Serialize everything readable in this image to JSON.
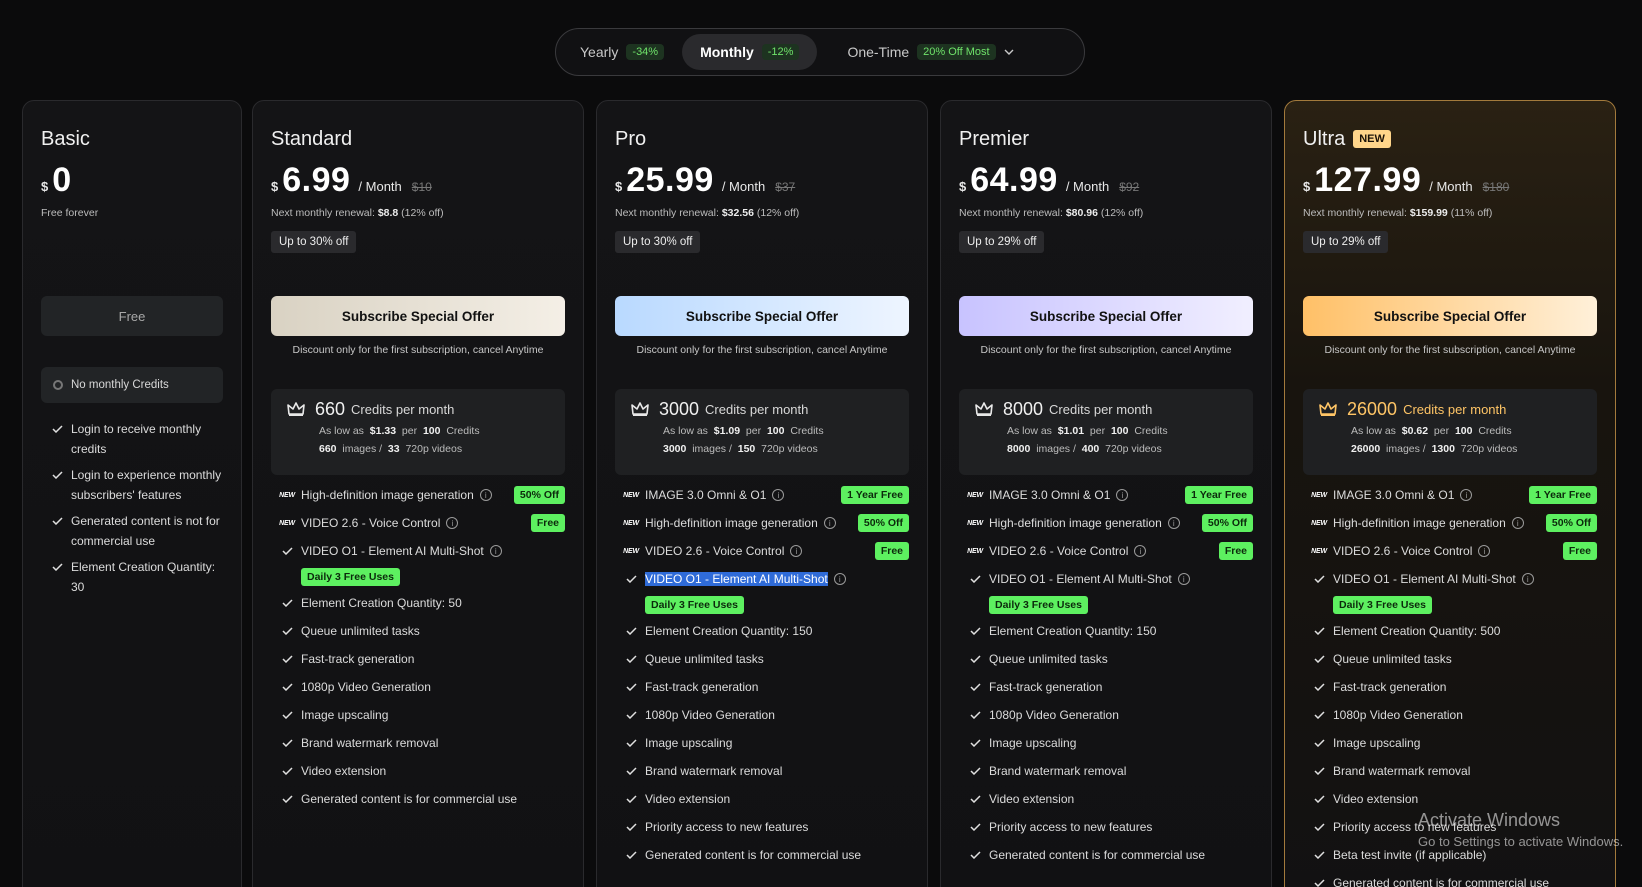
{
  "billing": {
    "options": [
      {
        "label": "Yearly",
        "badge": "-34%"
      },
      {
        "label": "Monthly",
        "badge": "-12%"
      },
      {
        "label": "One-Time",
        "badge": "20% Off Most"
      }
    ]
  },
  "common": {
    "currency": "$",
    "period": "/ Month",
    "subscribe": "Subscribe Special Offer",
    "discount_note": "Discount only for the first subscription, cancel Anytime",
    "credits_suffix": "Credits per month",
    "as_low_as": "As low as",
    "per": "per",
    "credits_word": "Credits",
    "images_word": "images /",
    "videos_word": "720p videos",
    "daily": "Daily 3 Free Uses",
    "renewal_prefix": "Next monthly renewal:"
  },
  "basic": {
    "name": "Basic",
    "price": "0",
    "note": "Free forever",
    "button": "Free",
    "credits": "No monthly Credits",
    "features": [
      "Login to receive monthly credits",
      "Login to experience monthly subscribers' features",
      "Generated content is not for commercial use",
      "Element Creation Quantity: 30"
    ]
  },
  "standard": {
    "name": "Standard",
    "price": "6.99",
    "old": "$10",
    "renewal": "$8.8",
    "renewal_off": "(12% off)",
    "upto": "Up to 30% off",
    "credits": "660",
    "per_price": "$1.33",
    "per_count": "100",
    "images": "660",
    "videos": "33",
    "new_features": [
      {
        "text": "High-definition image generation",
        "badge": "50% Off"
      },
      {
        "text": "VIDEO 2.6 - Voice Control",
        "badge": "Free"
      }
    ],
    "daily_feature": "VIDEO O1 - Element AI Multi-Shot",
    "features": [
      "Element Creation Quantity: 50",
      "Queue unlimited tasks",
      "Fast-track generation",
      "1080p Video Generation",
      "Image upscaling",
      "Brand watermark removal",
      "Video extension",
      "Generated content is for commercial use"
    ]
  },
  "pro": {
    "name": "Pro",
    "price": "25.99",
    "old": "$37",
    "renewal": "$32.56",
    "renewal_off": "(12% off)",
    "upto": "Up to 30% off",
    "credits": "3000",
    "per_price": "$1.09",
    "per_count": "100",
    "images": "3000",
    "videos": "150",
    "new_features": [
      {
        "text": "IMAGE 3.0 Omni & O1",
        "badge": "1 Year Free"
      },
      {
        "text": "High-definition image generation",
        "badge": "50% Off"
      },
      {
        "text": "VIDEO 2.6 - Voice Control",
        "badge": "Free"
      }
    ],
    "daily_feature": "VIDEO O1 - Element AI Multi-Shot",
    "features": [
      "Element Creation Quantity: 150",
      "Queue unlimited tasks",
      "Fast-track generation",
      "1080p Video Generation",
      "Image upscaling",
      "Brand watermark removal",
      "Video extension",
      "Priority access to new features",
      "Generated content is for commercial use"
    ]
  },
  "premier": {
    "name": "Premier",
    "price": "64.99",
    "old": "$92",
    "renewal": "$80.96",
    "renewal_off": "(12% off)",
    "upto": "Up to 29% off",
    "credits": "8000",
    "per_price": "$1.01",
    "per_count": "100",
    "images": "8000",
    "videos": "400",
    "new_features": [
      {
        "text": "IMAGE 3.0 Omni & O1",
        "badge": "1 Year Free"
      },
      {
        "text": "High-definition image generation",
        "badge": "50% Off"
      },
      {
        "text": "VIDEO 2.6 - Voice Control",
        "badge": "Free"
      }
    ],
    "daily_feature": "VIDEO O1 - Element AI Multi-Shot",
    "features": [
      "Element Creation Quantity: 150",
      "Queue unlimited tasks",
      "Fast-track generation",
      "1080p Video Generation",
      "Image upscaling",
      "Brand watermark removal",
      "Video extension",
      "Priority access to new features",
      "Generated content is for commercial use"
    ]
  },
  "ultra": {
    "name": "Ultra",
    "tag": "NEW",
    "price": "127.99",
    "old": "$180",
    "renewal": "$159.99",
    "renewal_off": "(11% off)",
    "upto": "Up to 29% off",
    "credits": "26000",
    "per_price": "$0.62",
    "per_count": "100",
    "images": "26000",
    "videos": "1300",
    "new_features": [
      {
        "text": "IMAGE 3.0 Omni & O1",
        "badge": "1 Year Free"
      },
      {
        "text": "High-definition image generation",
        "badge": "50% Off"
      },
      {
        "text": "VIDEO 2.6 - Voice Control",
        "badge": "Free"
      }
    ],
    "daily_feature": "VIDEO O1 - Element AI Multi-Shot",
    "features": [
      "Element Creation Quantity: 500",
      "Queue unlimited tasks",
      "Fast-track generation",
      "1080p Video Generation",
      "Image upscaling",
      "Brand watermark removal",
      "Video extension",
      "Priority access to new features",
      "Beta test invite (if applicable)",
      "Generated content is for commercial use"
    ]
  },
  "watermark": {
    "line1": "Activate Windows",
    "line2": "Go to Settings to activate Windows."
  },
  "colors": {
    "badge_green": "#5df060",
    "ultra_gold": "#ffc566",
    "background": "#0b0b0c"
  }
}
